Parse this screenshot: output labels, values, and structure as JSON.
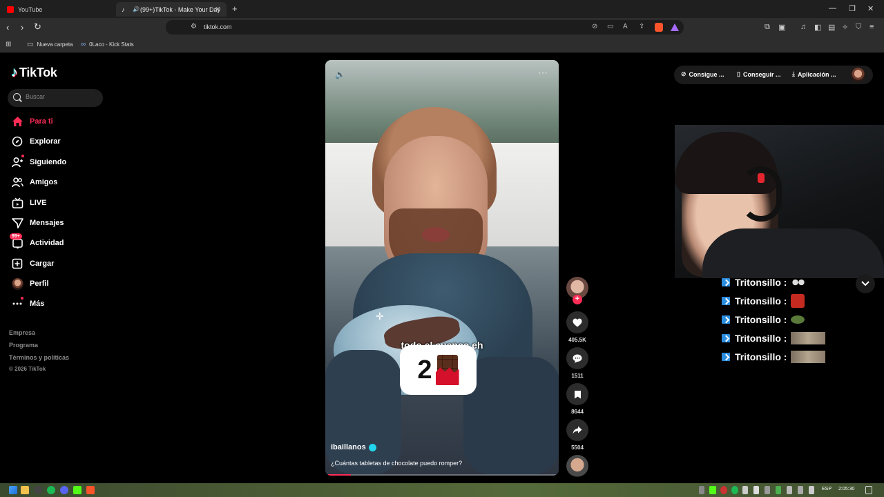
{
  "browser": {
    "tabs": [
      {
        "label": "YouTube",
        "active": false
      },
      {
        "label": "(99+)TikTok - Make Your Day",
        "active": true
      }
    ],
    "url": "tiktok.com",
    "bookmarks": [
      {
        "label": "Nueva carpeta",
        "icon": "folder-icon"
      },
      {
        "label": "0Laco - Kick Stats",
        "icon": "kick-stats-icon"
      }
    ]
  },
  "sidebar": {
    "logo_text": "TikTok",
    "search_placeholder": "Buscar",
    "nav": [
      {
        "label": "Para ti",
        "icon": "home-icon",
        "active": true
      },
      {
        "label": "Explorar",
        "icon": "compass-icon"
      },
      {
        "label": "Siguiendo",
        "icon": "following-icon"
      },
      {
        "label": "Amigos",
        "icon": "friends-icon"
      },
      {
        "label": "LIVE",
        "icon": "live-icon"
      },
      {
        "label": "Mensajes",
        "icon": "messages-icon"
      },
      {
        "label": "Actividad",
        "icon": "activity-icon",
        "badge": "99+"
      },
      {
        "label": "Cargar",
        "icon": "upload-icon"
      },
      {
        "label": "Perfil",
        "icon": "profile-avatar"
      },
      {
        "label": "Más",
        "icon": "more-icon"
      }
    ],
    "footer": [
      "Empresa",
      "Programa",
      "Términos y políticas",
      "© 2026 TikTok"
    ]
  },
  "video": {
    "caption_overlay": "todo el cuenco eh",
    "badge_number": "2",
    "author": "ibaillanos",
    "description": "¿Cuántas tabletas de chocolate puedo romper?",
    "progress": 0.1
  },
  "actions": {
    "likes": "405.5K",
    "comments": "1511",
    "saves": "8644",
    "shares": "5504"
  },
  "top_actions": [
    {
      "label": "Consigue ...",
      "icon": "coin-icon"
    },
    {
      "label": "Conseguir ...",
      "icon": "phone-icon"
    },
    {
      "label": "Aplicación ...",
      "icon": "download-icon"
    }
  ],
  "chat": [
    {
      "name": "Tritonsillo :"
    },
    {
      "name": "Tritonsillo :"
    },
    {
      "name": "Tritonsillo :"
    },
    {
      "name": "Tritonsillo :"
    },
    {
      "name": "Tritonsillo :"
    }
  ],
  "taskbar": {
    "lang": "ESP",
    "time": "2:05:30"
  },
  "colors": {
    "accent": "#fe2c55",
    "kick": "#2a8de0",
    "verified": "#20d5ec"
  }
}
